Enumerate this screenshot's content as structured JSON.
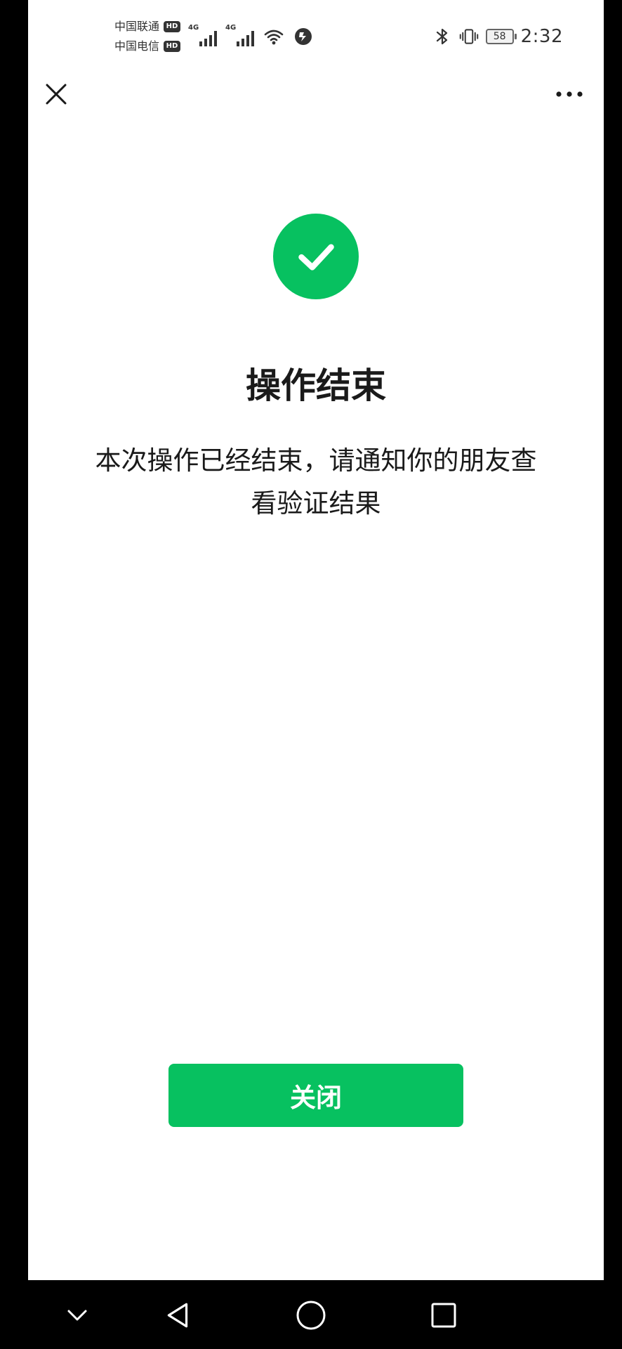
{
  "status_bar": {
    "carriers": [
      {
        "name": "中国联通",
        "badge": "HD"
      },
      {
        "name": "中国电信",
        "badge": "HD"
      }
    ],
    "network_labels": [
      "4G",
      "4G"
    ],
    "battery_level": "58",
    "time": "2:32"
  },
  "icons": {
    "close": "close-icon",
    "more": "more-icon",
    "success": "checkmark-icon",
    "bluetooth": "bluetooth-icon",
    "vibrate": "vibrate-icon",
    "wifi": "wifi-icon",
    "data": "data-icon"
  },
  "main": {
    "title": "操作结束",
    "description_line1": "本次操作已经结束，请通知你的朋友查",
    "description_line2": "看验证结果",
    "close_button_label": "关闭"
  },
  "colors": {
    "accent": "#07c160",
    "text": "#1a1a1a",
    "background": "#ffffff"
  }
}
